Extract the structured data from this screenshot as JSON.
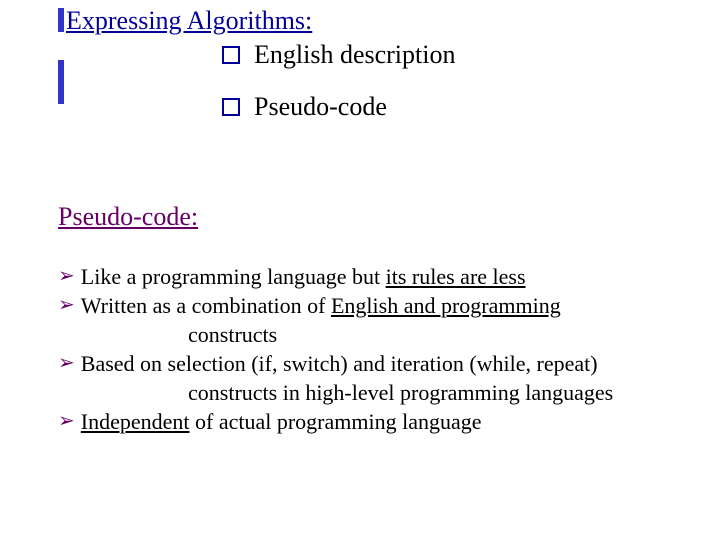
{
  "title": "Expressing Algorithms:",
  "square_items": [
    "English description",
    "Pseudo-code"
  ],
  "subheading": "Pseudo-code:",
  "bullets": {
    "b1_lead": "Like a programming language but ",
    "b1_ul": "its rules are less",
    "b2_line1_lead": "Written as a combination of ",
    "b2_line1_ul": "English and programming",
    "b2_line2": "constructs",
    "b3_line1": "Based on selection (if, switch) and iteration (while, repeat)",
    "b3_line2": "constructs in high-level programming languages",
    "b4_ul": "Independent",
    "b4_tail": " of actual programming language"
  }
}
